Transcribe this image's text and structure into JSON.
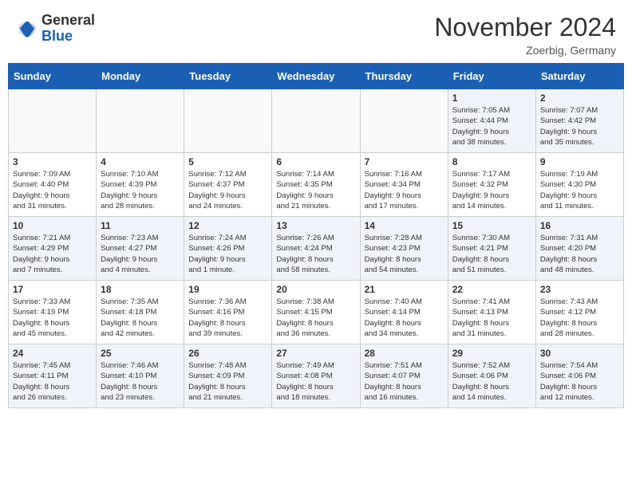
{
  "header": {
    "logo_general": "General",
    "logo_blue": "Blue",
    "month_title": "November 2024",
    "location": "Zoerbig, Germany"
  },
  "weekdays": [
    "Sunday",
    "Monday",
    "Tuesday",
    "Wednesday",
    "Thursday",
    "Friday",
    "Saturday"
  ],
  "weeks": [
    [
      {
        "day": "",
        "info": ""
      },
      {
        "day": "",
        "info": ""
      },
      {
        "day": "",
        "info": ""
      },
      {
        "day": "",
        "info": ""
      },
      {
        "day": "",
        "info": ""
      },
      {
        "day": "1",
        "info": "Sunrise: 7:05 AM\nSunset: 4:44 PM\nDaylight: 9 hours\nand 38 minutes."
      },
      {
        "day": "2",
        "info": "Sunrise: 7:07 AM\nSunset: 4:42 PM\nDaylight: 9 hours\nand 35 minutes."
      }
    ],
    [
      {
        "day": "3",
        "info": "Sunrise: 7:09 AM\nSunset: 4:40 PM\nDaylight: 9 hours\nand 31 minutes."
      },
      {
        "day": "4",
        "info": "Sunrise: 7:10 AM\nSunset: 4:39 PM\nDaylight: 9 hours\nand 28 minutes."
      },
      {
        "day": "5",
        "info": "Sunrise: 7:12 AM\nSunset: 4:37 PM\nDaylight: 9 hours\nand 24 minutes."
      },
      {
        "day": "6",
        "info": "Sunrise: 7:14 AM\nSunset: 4:35 PM\nDaylight: 9 hours\nand 21 minutes."
      },
      {
        "day": "7",
        "info": "Sunrise: 7:16 AM\nSunset: 4:34 PM\nDaylight: 9 hours\nand 17 minutes."
      },
      {
        "day": "8",
        "info": "Sunrise: 7:17 AM\nSunset: 4:32 PM\nDaylight: 9 hours\nand 14 minutes."
      },
      {
        "day": "9",
        "info": "Sunrise: 7:19 AM\nSunset: 4:30 PM\nDaylight: 9 hours\nand 11 minutes."
      }
    ],
    [
      {
        "day": "10",
        "info": "Sunrise: 7:21 AM\nSunset: 4:29 PM\nDaylight: 9 hours\nand 7 minutes."
      },
      {
        "day": "11",
        "info": "Sunrise: 7:23 AM\nSunset: 4:27 PM\nDaylight: 9 hours\nand 4 minutes."
      },
      {
        "day": "12",
        "info": "Sunrise: 7:24 AM\nSunset: 4:26 PM\nDaylight: 9 hours\nand 1 minute."
      },
      {
        "day": "13",
        "info": "Sunrise: 7:26 AM\nSunset: 4:24 PM\nDaylight: 8 hours\nand 58 minutes."
      },
      {
        "day": "14",
        "info": "Sunrise: 7:28 AM\nSunset: 4:23 PM\nDaylight: 8 hours\nand 54 minutes."
      },
      {
        "day": "15",
        "info": "Sunrise: 7:30 AM\nSunset: 4:21 PM\nDaylight: 8 hours\nand 51 minutes."
      },
      {
        "day": "16",
        "info": "Sunrise: 7:31 AM\nSunset: 4:20 PM\nDaylight: 8 hours\nand 48 minutes."
      }
    ],
    [
      {
        "day": "17",
        "info": "Sunrise: 7:33 AM\nSunset: 4:19 PM\nDaylight: 8 hours\nand 45 minutes."
      },
      {
        "day": "18",
        "info": "Sunrise: 7:35 AM\nSunset: 4:18 PM\nDaylight: 8 hours\nand 42 minutes."
      },
      {
        "day": "19",
        "info": "Sunrise: 7:36 AM\nSunset: 4:16 PM\nDaylight: 8 hours\nand 39 minutes."
      },
      {
        "day": "20",
        "info": "Sunrise: 7:38 AM\nSunset: 4:15 PM\nDaylight: 8 hours\nand 36 minutes."
      },
      {
        "day": "21",
        "info": "Sunrise: 7:40 AM\nSunset: 4:14 PM\nDaylight: 8 hours\nand 34 minutes."
      },
      {
        "day": "22",
        "info": "Sunrise: 7:41 AM\nSunset: 4:13 PM\nDaylight: 8 hours\nand 31 minutes."
      },
      {
        "day": "23",
        "info": "Sunrise: 7:43 AM\nSunset: 4:12 PM\nDaylight: 8 hours\nand 28 minutes."
      }
    ],
    [
      {
        "day": "24",
        "info": "Sunrise: 7:45 AM\nSunset: 4:11 PM\nDaylight: 8 hours\nand 26 minutes."
      },
      {
        "day": "25",
        "info": "Sunrise: 7:46 AM\nSunset: 4:10 PM\nDaylight: 8 hours\nand 23 minutes."
      },
      {
        "day": "26",
        "info": "Sunrise: 7:48 AM\nSunset: 4:09 PM\nDaylight: 8 hours\nand 21 minutes."
      },
      {
        "day": "27",
        "info": "Sunrise: 7:49 AM\nSunset: 4:08 PM\nDaylight: 8 hours\nand 18 minutes."
      },
      {
        "day": "28",
        "info": "Sunrise: 7:51 AM\nSunset: 4:07 PM\nDaylight: 8 hours\nand 16 minutes."
      },
      {
        "day": "29",
        "info": "Sunrise: 7:52 AM\nSunset: 4:06 PM\nDaylight: 8 hours\nand 14 minutes."
      },
      {
        "day": "30",
        "info": "Sunrise: 7:54 AM\nSunset: 4:06 PM\nDaylight: 8 hours\nand 12 minutes."
      }
    ]
  ]
}
